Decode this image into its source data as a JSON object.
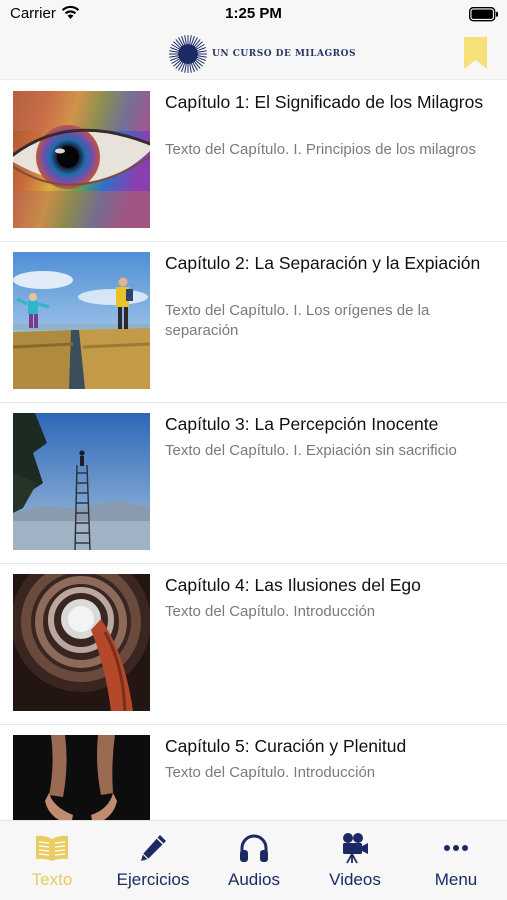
{
  "status_bar": {
    "carrier": "Carrier",
    "time": "1:25 PM"
  },
  "header": {
    "logo_text": "UN CURSO DE MILAGROS",
    "bookmark_icon": "bookmark-icon",
    "logo_color": "#1c2a63",
    "bookmark_color": "#f5e07a"
  },
  "chapters": [
    {
      "title": "Capítulo 1: El Significado de los Milagros",
      "subtitle": "Texto del Capítulo. I. Principios de los milagros",
      "image": "rainbow-eye"
    },
    {
      "title": "Capítulo 2: La Separación y la Expiación",
      "subtitle": "Texto del Capítulo. I. Los orígenes de la separación",
      "image": "children-over-creek"
    },
    {
      "title": "Capítulo 3: La Percepción Inocente",
      "subtitle": "Texto del Capítulo. I. Expiación sin sacrificio",
      "image": "ladder-to-sky"
    },
    {
      "title": "Capítulo 4: Las Ilusiones del Ego",
      "subtitle": "Texto del Capítulo. Introducción",
      "image": "spiral-staircase"
    },
    {
      "title": "Capítulo 5: Curación y Plenitud",
      "subtitle": "Texto del Capítulo. Introducción",
      "image": "open-hands"
    }
  ],
  "tabs": [
    {
      "label": "Texto",
      "icon": "open-book-icon",
      "active": true
    },
    {
      "label": "Ejercicios",
      "icon": "pencil-icon",
      "active": false
    },
    {
      "label": "Audios",
      "icon": "headphones-icon",
      "active": false
    },
    {
      "label": "Videos",
      "icon": "video-camera-icon",
      "active": false
    },
    {
      "label": "Menu",
      "icon": "more-dots-icon",
      "active": false
    }
  ],
  "colors": {
    "tab_active": "#e9cd62",
    "tab_inactive": "#1c2a63"
  }
}
